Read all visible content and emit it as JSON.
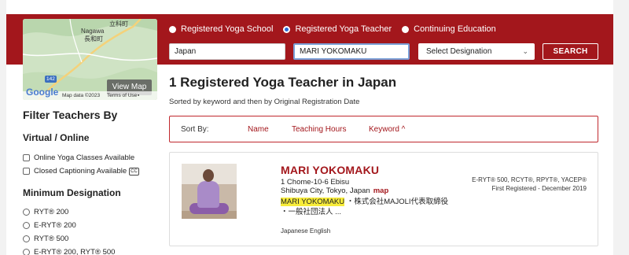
{
  "map": {
    "places": [
      "Nagawa",
      "長和町"
    ],
    "route_number": "142",
    "view_button": "View Map",
    "google_logo": "Google",
    "map_data": "Map data ©2023",
    "terms": "Terms of Use"
  },
  "search": {
    "type_options": [
      {
        "label": "Registered Yoga School",
        "selected": false
      },
      {
        "label": "Registered Yoga Teacher",
        "selected": true
      },
      {
        "label": "Continuing Education",
        "selected": false
      }
    ],
    "location_value": "Japan",
    "keyword_value": "MARI YOKOMAKU",
    "designation_value": "Select Designation",
    "search_button": "SEARCH"
  },
  "results": {
    "title": "1 Registered Yoga Teacher in Japan",
    "sorted_note": "Sorted by keyword and then by Original Registration Date"
  },
  "sort": {
    "label": "Sort By:",
    "options": [
      "Name",
      "Teaching Hours",
      "Keyword ^"
    ]
  },
  "filters": {
    "title": "Filter Teachers By",
    "virtual_heading": "Virtual / Online",
    "online_classes": "Online Yoga Classes Available",
    "closed_captioning": "Closed Captioning Available",
    "cc_badge": "CC",
    "designation_heading": "Minimum Designation",
    "designations": [
      "RYT® 200",
      "E-RYT® 200",
      "RYT® 500",
      "E-RYT® 200, RYT® 500"
    ]
  },
  "teacher": {
    "name": "MARI YOKOMAKU",
    "address_line1": "1 Chome-10-6 Ebisu",
    "address_line2": "Shibuya City, Tokyo, Japan",
    "map_link": "map",
    "desc_highlight": "MARI YOKOMAKU",
    "desc_rest": " ・株式会社MAJOLI代表取締役",
    "desc_line2": "・一般社団法人 ...",
    "languages": "Japanese English",
    "credentials": "E-RYT® 500, RCYT®, RPYT®, YACEP®",
    "first_registered": "First Registered - December 2019"
  },
  "colors": {
    "brand_red": "#a3171c",
    "highlight": "#f7ec3a"
  }
}
